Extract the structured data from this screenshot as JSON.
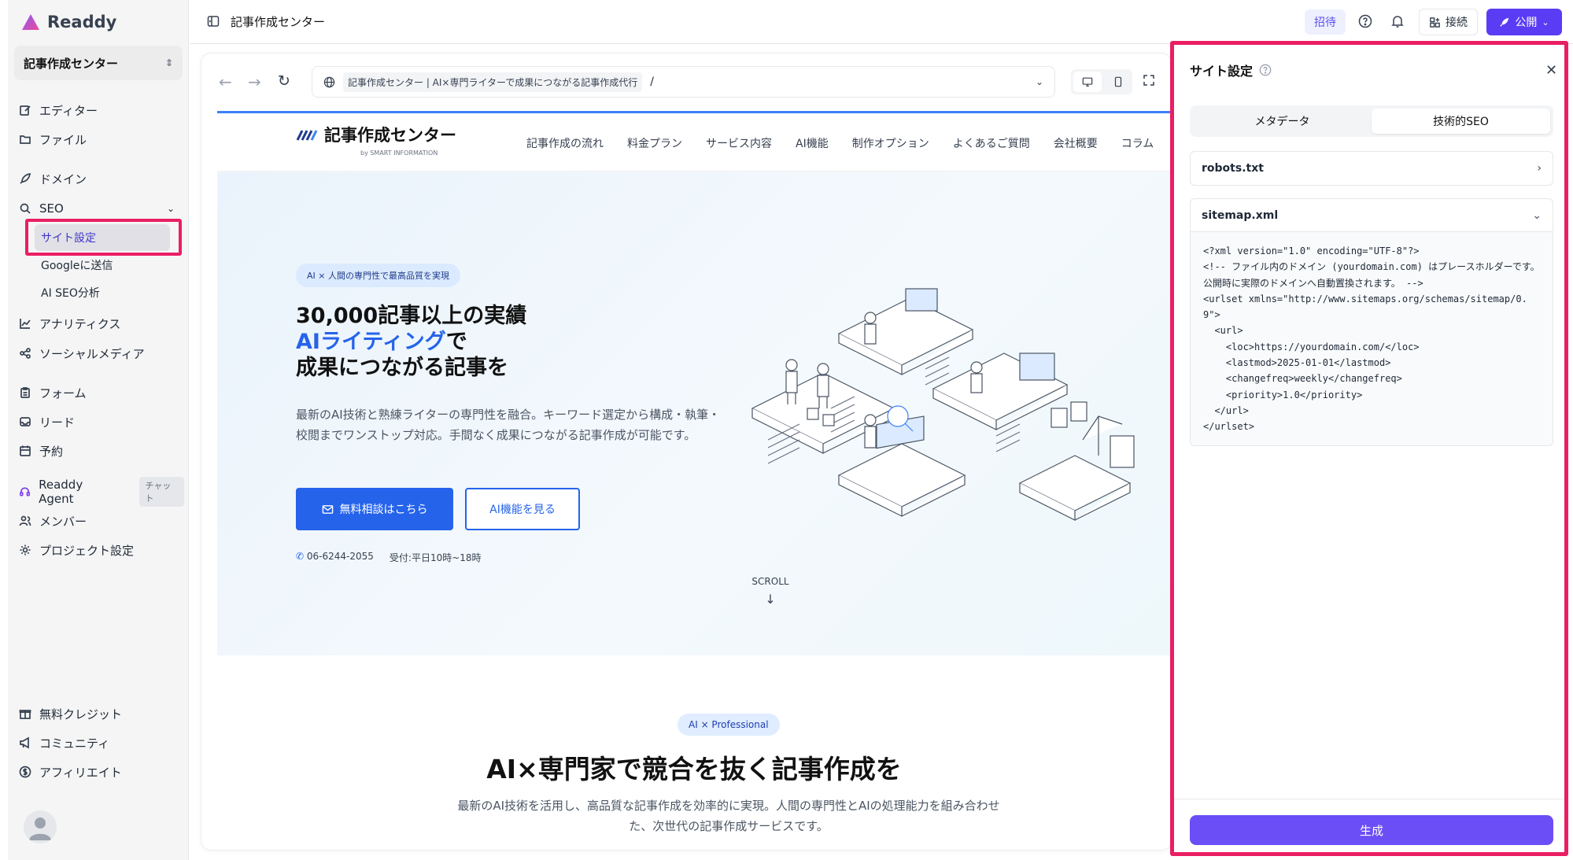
{
  "sidebar": {
    "logo": "Readdy",
    "project": "記事作成センター",
    "items": {
      "editor": "エディター",
      "files": "ファイル",
      "domain": "ドメイン",
      "seo": "SEO",
      "analytics": "アナリティクス",
      "social": "ソーシャルメディア",
      "forms": "フォーム",
      "leads": "リード",
      "booking": "予約",
      "agent": "Readdy Agent",
      "agent_tag": "チャット",
      "members": "メンバー",
      "project_settings": "プロジェクト設定",
      "credits": "無料クレジット",
      "community": "コミュニティ",
      "affiliate": "アフィリエイト"
    },
    "seo_sub": {
      "site_settings": "サイト設定",
      "google": "Googleに送信",
      "ai_seo": "AI SEO分析"
    }
  },
  "topbar": {
    "title": "記事作成センター",
    "invite": "招待",
    "connect": "接続",
    "publish": "公開"
  },
  "browser": {
    "page_title": "記事作成センター | AI×専門ライターで成果につながる記事作成代行",
    "path": "/"
  },
  "site": {
    "logo": "記事作成センター",
    "logo_by": "by SMART INFORMATION",
    "nav": [
      "記事作成の流れ",
      "料金プラン",
      "サービス内容",
      "AI機能",
      "制作オプション",
      "よくあるご質問",
      "会社概要",
      "コラム"
    ],
    "hero_badge": "AI × 人間の専門性で最高品質を実現",
    "hero_line1": "30,000記事以上の実績",
    "hero_line2_blue": "AIライティング",
    "hero_line2_rest": "で",
    "hero_line3": "成果につながる記事を",
    "hero_desc": "最新のAI技術と熟練ライターの専門性を融合。キーワード選定から構成・執筆・校閲までワンストップ対応。手間なく成果につながる記事作成が可能です。",
    "btn_contact": "無料相談はこちら",
    "btn_ai": "AI機能を見る",
    "phone": "06-6244-2055",
    "hours": "受付:平日10時~18時",
    "scroll": "SCROLL",
    "s2_badge": "AI × Professional",
    "s2_title": "AI×専門家で競合を抜く記事作成を",
    "s2_desc": "最新のAI技術を活用し、高品質な記事作成を効率的に実現。人間の専門性とAIの処理能力を組み合わせた、次世代の記事作成サービスです。"
  },
  "panel": {
    "title": "サイト設定",
    "tabs": [
      "メタデータ",
      "技術的SEO"
    ],
    "robots": "robots.txt",
    "sitemap": "sitemap.xml",
    "sitemap_code": "<?xml version=\"1.0\" encoding=\"UTF-8\"?>\n<!-- ファイル内のドメイン (yourdomain.com) はプレースホルダーです。公開時に実際のドメインへ自動置換されます。 -->\n<urlset xmlns=\"http://www.sitemaps.org/schemas/sitemap/0.9\">\n  <url>\n    <loc>https://yourdomain.com/</loc>\n    <lastmod>2025-01-01</lastmod>\n    <changefreq>weekly</changefreq>\n    <priority>1.0</priority>\n  </url>\n</urlset>",
    "generate": "生成"
  },
  "colors": {
    "accent": "#5b3cf5",
    "highlight": "#ea1e64",
    "site_blue": "#2563eb"
  }
}
